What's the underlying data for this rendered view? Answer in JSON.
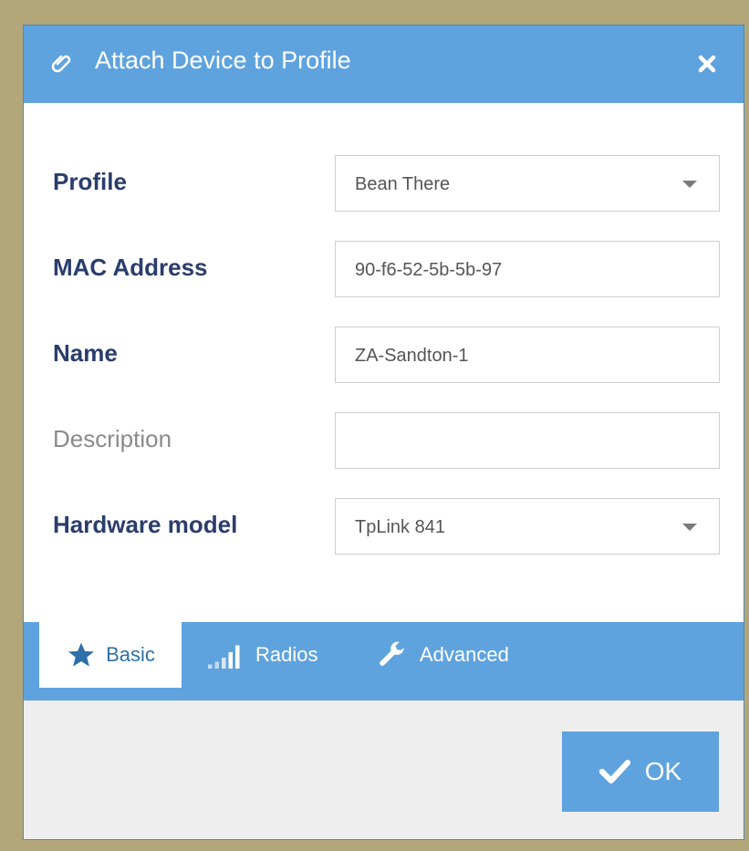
{
  "dialog": {
    "title": "Attach Device to Profile",
    "title_icon": "paperclip-icon",
    "close_icon": "close-icon"
  },
  "form": {
    "profile": {
      "label": "Profile",
      "value": "Bean There"
    },
    "mac_address": {
      "label": "MAC Address",
      "value": "90-f6-52-5b-5b-97"
    },
    "name": {
      "label": "Name",
      "value": "ZA-Sandton-1"
    },
    "description": {
      "label": "Description",
      "value": ""
    },
    "hardware_model": {
      "label": "Hardware model",
      "value": "TpLink 841"
    }
  },
  "tabs": [
    {
      "label": "Basic",
      "icon": "star-icon",
      "active": true
    },
    {
      "label": "Radios",
      "icon": "signal-bars-icon",
      "active": false
    },
    {
      "label": "Advanced",
      "icon": "wrench-icon",
      "active": false
    }
  ],
  "footer": {
    "ok_label": "OK",
    "ok_icon": "checkmark-icon"
  },
  "colors": {
    "accent": "#5fa3de",
    "label": "#2a3d6b",
    "backdrop": "#b3a779"
  }
}
